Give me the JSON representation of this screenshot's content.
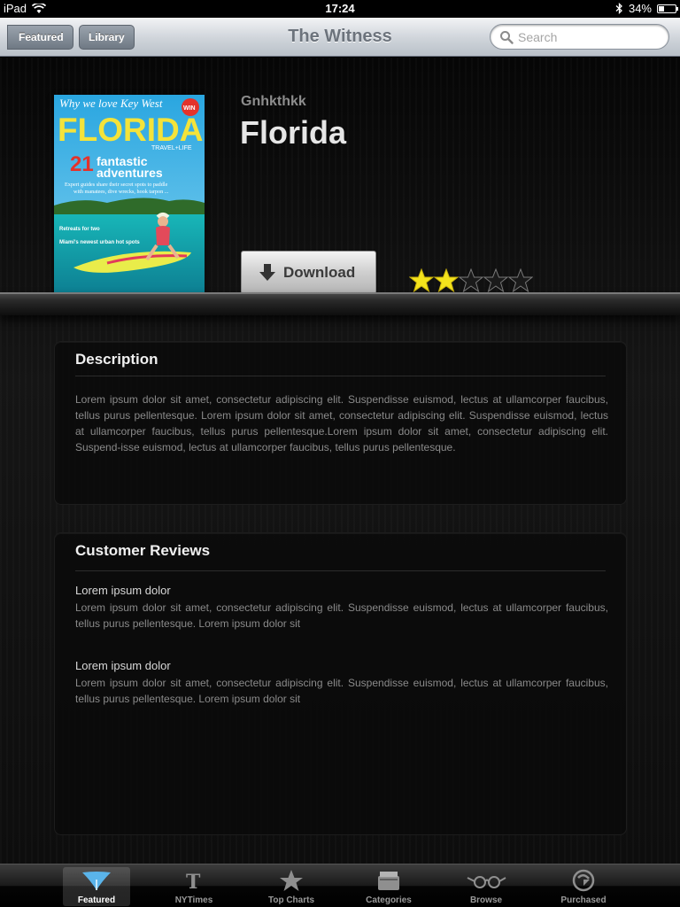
{
  "status": {
    "device": "iPad",
    "time": "17:24",
    "battery": "34%",
    "battery_level": 0.34
  },
  "nav": {
    "back_label": "Featured",
    "library_label": "Library",
    "title": "The Witness",
    "search_placeholder": "Search"
  },
  "magazine": {
    "publisher": "Gnhkthkk",
    "title": "Florida",
    "download_label": "Download",
    "rating": 2,
    "rating_max": 5,
    "cover": {
      "tagline": "Why we love Key West",
      "masthead": "FLORIDA",
      "sub": "TRAVEL+LIFE",
      "badge": "WIN",
      "headline_num": "21",
      "headline_1": "fantastic",
      "headline_2": "adventures",
      "deck_1": "Expert guides share their secret spots to paddle",
      "deck_2": "with manatees, dive wrecks, hook tarpon ...",
      "side_1": "Retreats for two",
      "side_2": "Miami's newest urban hot spots"
    }
  },
  "description": {
    "heading": "Description",
    "text": "Lorem ipsum dolor sit amet, consectetur adipiscing elit. Suspendisse euismod, lectus at ullamcorper faucibus, tellus purus pellentesque. Lorem ipsum dolor sit amet, consectetur adipiscing elit. Suspendisse euismod, lectus at ullamcorper faucibus, tellus purus pellentesque.Lorem ipsum dolor sit amet, consectetur adipiscing elit. Suspend-isse euismod, lectus at ullamcorper faucibus, tellus purus pellentesque."
  },
  "reviews": {
    "heading": "Customer Reviews",
    "items": [
      {
        "title": "Lorem ipsum dolor",
        "text": "Lorem ipsum dolor sit amet, consectetur adipiscing elit. Suspendisse euismod, lectus at ullamcorper faucibus, tellus purus pellentesque. Lorem ipsum dolor sit"
      },
      {
        "title": "Lorem ipsum dolor",
        "text": "Lorem ipsum dolor sit amet, consectetur adipiscing elit. Suspendisse euismod, lectus at ullamcorper faucibus, tellus purus pellentesque. Lorem ipsum dolor sit"
      }
    ]
  },
  "tabs": [
    {
      "label": "Featured",
      "icon": "featured-icon",
      "active": true
    },
    {
      "label": "NYTimes",
      "icon": "nytimes-icon",
      "active": false
    },
    {
      "label": "Top Charts",
      "icon": "star-icon",
      "active": false
    },
    {
      "label": "Categories",
      "icon": "categories-icon",
      "active": false
    },
    {
      "label": "Browse",
      "icon": "glasses-icon",
      "active": false
    },
    {
      "label": "Purchased",
      "icon": "purchased-icon",
      "active": false
    }
  ]
}
